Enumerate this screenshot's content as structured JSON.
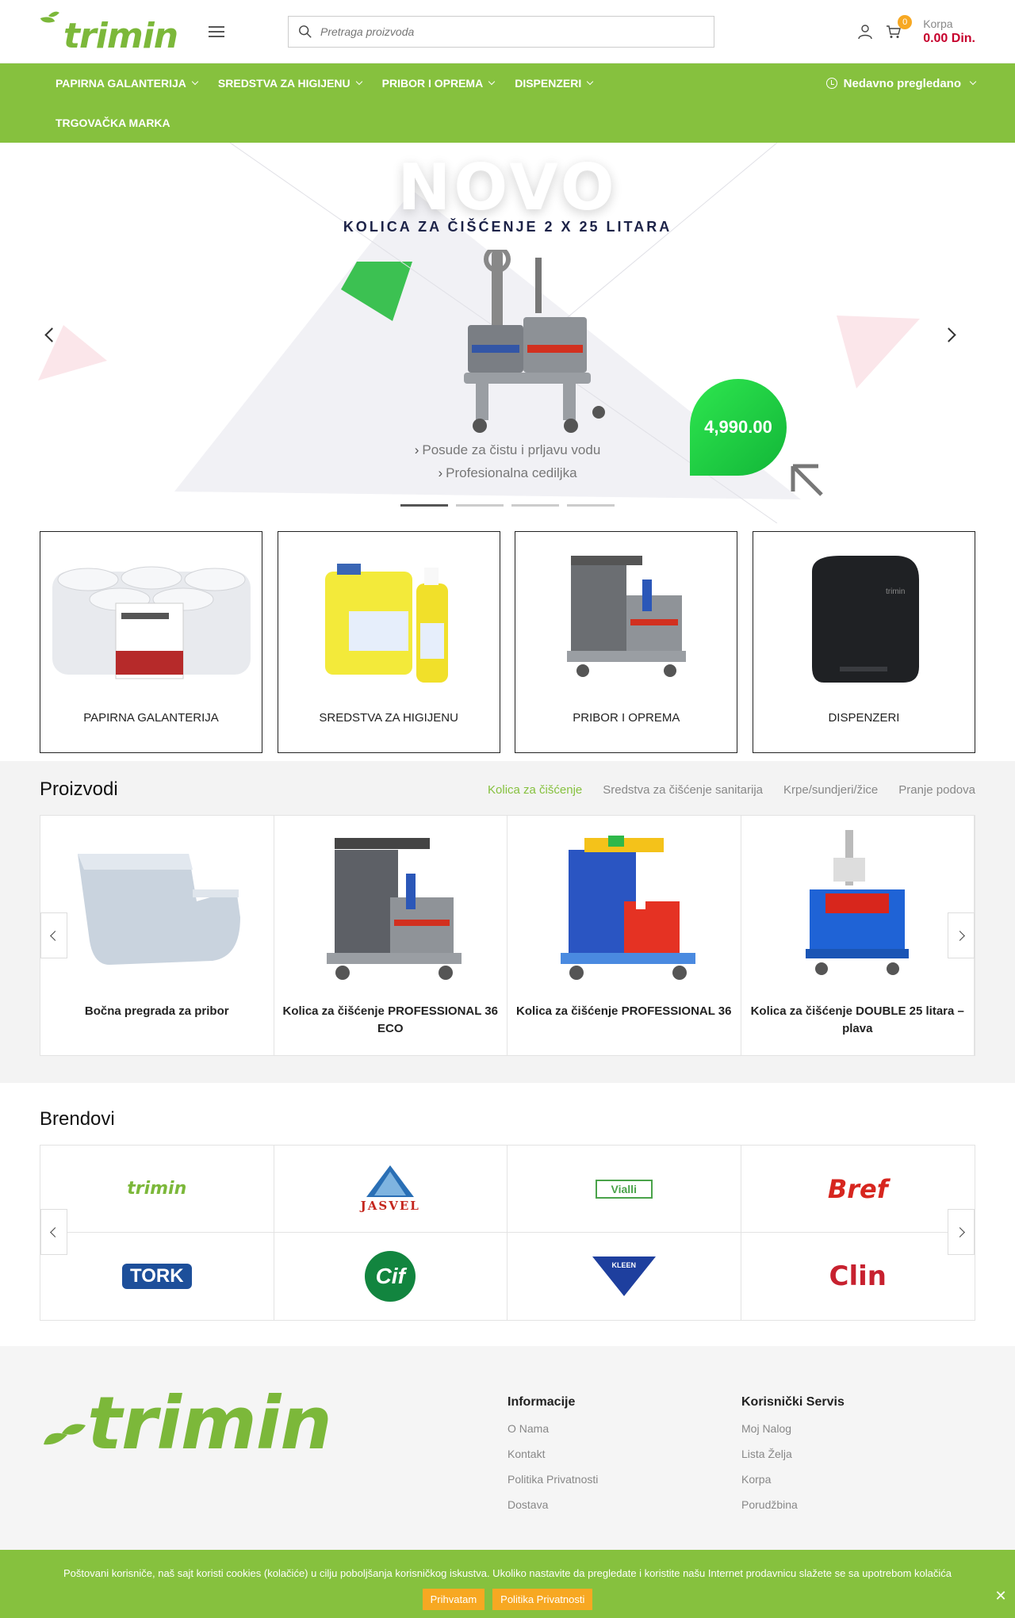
{
  "header": {
    "logo_text": "trimin",
    "search_placeholder": "Pretraga proizvoda",
    "cart_count": "0",
    "cart_label": "Korpa",
    "cart_amount": "0.00 Din."
  },
  "nav": {
    "items": [
      "PAPIRNA GALANTERIJA",
      "SREDSTVA ZA HIGIJENU",
      "PRIBOR I OPREMA",
      "DISPENZERI"
    ],
    "second_row": "TRGOVAČKA MARKA",
    "recent": "Nedavno pregledano"
  },
  "hero": {
    "headline": "NOVO",
    "subtitle": "KOLICA ZA ČIŠĆENJE 2 X 25 LITARA",
    "features": [
      "Posude za čistu i prljavu vodu",
      "Profesionalna cedilјka"
    ],
    "price": "4,990.00",
    "slide_count": 4,
    "active_slide": 1
  },
  "categories": [
    {
      "label": "PAPIRNA GALANTERIJA"
    },
    {
      "label": "SREDSTVA ZA HIGIJENU"
    },
    {
      "label": "PRIBOR I OPREMA"
    },
    {
      "label": "DISPENZERI"
    }
  ],
  "products": {
    "title": "Proizvodi",
    "tabs": [
      "Kolica za čišćenje",
      "Sredstva za čišćenje sanitarija",
      "Krpe/sundjeri/žice",
      "Pranje podova"
    ],
    "active_tab": 0,
    "items": [
      {
        "name": "Bočna pregrada za pribor"
      },
      {
        "name": "Kolica za čišćenje PROFESSIONAL 36 ECO"
      },
      {
        "name": "Kolica za čišćenje PROFESSIONAL 36"
      },
      {
        "name": "Kolica za čišćenje DOUBLE 25 litara – plava"
      }
    ]
  },
  "brands": {
    "title": "Brendovi",
    "items": [
      "trimin",
      "JASVEL",
      "Vialli",
      "Bref",
      "TORK",
      "Cif",
      "KLEEN",
      "Clin"
    ]
  },
  "footer": {
    "logo_text": "trimin",
    "info_title": "Informacije",
    "info_links": [
      "O Nama",
      "Kontakt",
      "Politika Privatnosti",
      "Dostava"
    ],
    "service_title": "Korisnički Servis",
    "service_links": [
      "Moj Nalog",
      "Lista Želja",
      "Korpa",
      "Porudžbina"
    ]
  },
  "cookie": {
    "text": "Poštovani korisniče, naš sajt koristi cookies (kolačiće) u cilju poboljšanja korisničkog iskustva. Ukoliko nastavite da pregledate i koristite našu Internet prodavnicu slažete se sa upotrebom kolačića",
    "accept": "Prihvatam",
    "policy": "Politika Privatnosti"
  },
  "colors": {
    "brand_green": "#86c13e",
    "accent_orange": "#f7a822",
    "price_red": "#c6002c"
  }
}
